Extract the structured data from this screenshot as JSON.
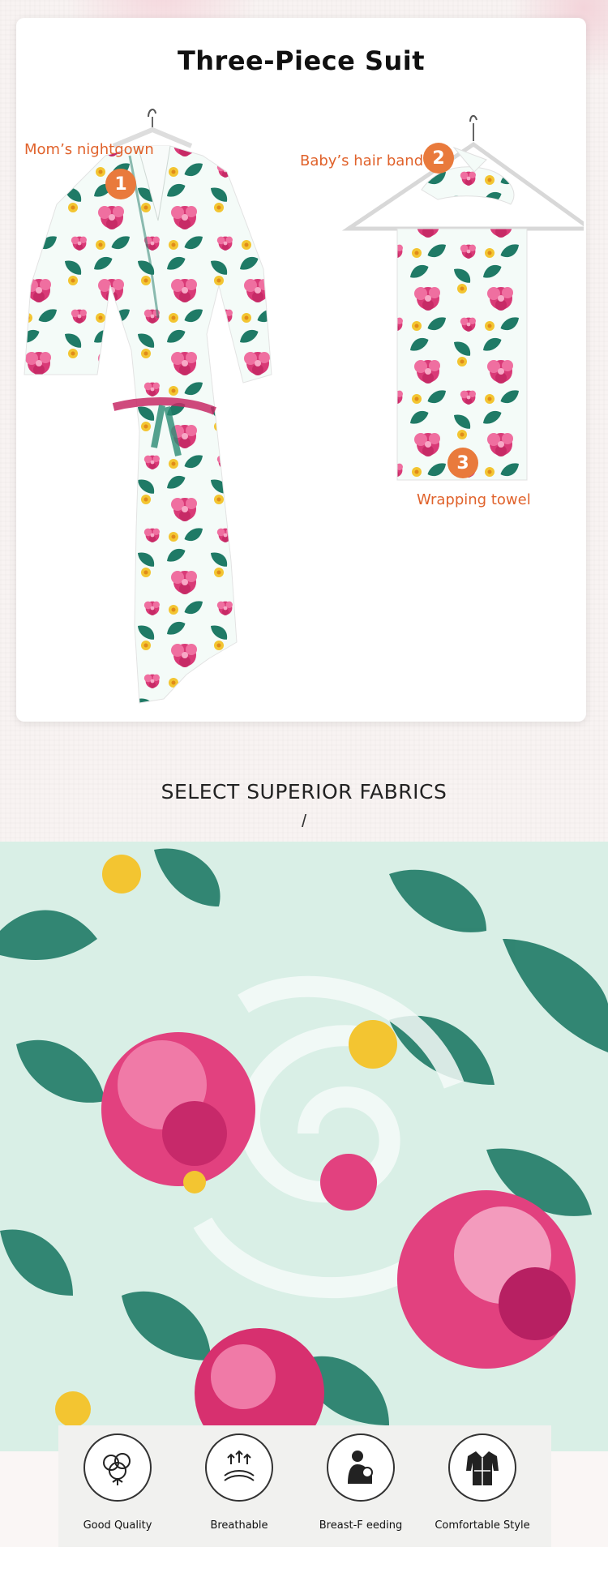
{
  "suit_card": {
    "title": "Three-Piece Suit",
    "items": [
      {
        "number": "1",
        "label": "Mom’s nightgown"
      },
      {
        "number": "2",
        "label": "Baby’s hair band"
      },
      {
        "number": "3",
        "label": "Wrapping towel"
      }
    ]
  },
  "fabrics_section": {
    "heading": "SELECT SUPERIOR FABRICS",
    "separator": "/"
  },
  "features": [
    {
      "icon": "cotton-icon",
      "label": "Good Quality"
    },
    {
      "icon": "breathable-icon",
      "label": "Breathable"
    },
    {
      "icon": "breastfeeding-icon",
      "label": "Breast-F eeding"
    },
    {
      "icon": "robe-icon",
      "label": "Comfortable Style"
    }
  ],
  "colors": {
    "accent_orange": "#e97a3c",
    "label_orange": "#e0622b",
    "rose_pink": "#d93a77",
    "leaf_teal": "#1f7a66",
    "fabric_mint": "#d9efe6"
  }
}
